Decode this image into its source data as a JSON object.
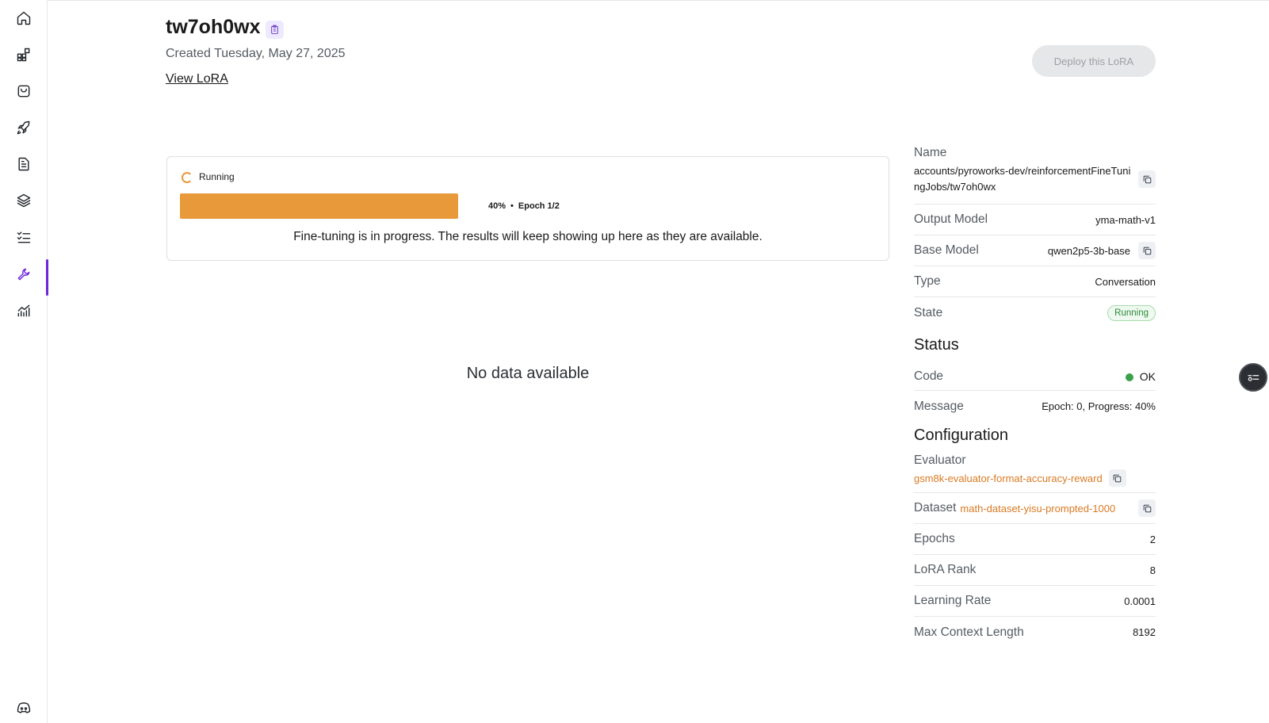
{
  "header": {
    "title": "tw7oh0wx",
    "created": "Created Tuesday, May 27, 2025",
    "view_lora": "View LoRA",
    "deploy_label": "Deploy this LoRA"
  },
  "sidebar": {
    "items": [
      {
        "name": "home",
        "icon": "home-icon"
      },
      {
        "name": "models",
        "icon": "grid-plus-icon"
      },
      {
        "name": "marketplace",
        "icon": "bag-icon"
      },
      {
        "name": "deployments",
        "icon": "rocket-icon"
      },
      {
        "name": "documents",
        "icon": "document-icon"
      },
      {
        "name": "layers",
        "icon": "layers-icon"
      },
      {
        "name": "tasks",
        "icon": "checklist-icon"
      },
      {
        "name": "fine-tuning",
        "icon": "wrench-icon",
        "active": true
      },
      {
        "name": "analytics",
        "icon": "chart-icon"
      }
    ],
    "bottom_icon": "discord-icon"
  },
  "progress": {
    "status": "Running",
    "percent": 40,
    "percent_label": "40%",
    "separator": "•",
    "epoch_label": "Epoch 1/2",
    "message": "Fine-tuning is in progress. The results will keep showing up here as they are available.",
    "bar_color": "#e8993a"
  },
  "chart_area": {
    "empty_message": "No data available"
  },
  "details": {
    "name_label": "Name",
    "name_value": "accounts/pyroworks-dev/reinforcementFineTuningJobs/tw7oh0wx",
    "output_model_label": "Output Model",
    "output_model_value": "yma-math-v1",
    "base_model_label": "Base Model",
    "base_model_value": "qwen2p5-3b-base",
    "type_label": "Type",
    "type_value": "Conversation",
    "state_label": "State",
    "state_value": "Running"
  },
  "status_section": {
    "heading": "Status",
    "code_label": "Code",
    "code_value": "OK",
    "message_label": "Message",
    "message_value": "Epoch: 0, Progress: 40%"
  },
  "config": {
    "heading": "Configuration",
    "evaluator_label": "Evaluator",
    "evaluator_value": "gsm8k-evaluator-format-accuracy-reward",
    "dataset_label": "Dataset",
    "dataset_value": "math-dataset-yisu-prompted-1000",
    "epochs_label": "Epochs",
    "epochs_value": "2",
    "lora_rank_label": "LoRA Rank",
    "lora_rank_value": "8",
    "learning_rate_label": "Learning Rate",
    "learning_rate_value": "0.0001",
    "max_context_label": "Max Context Length",
    "max_context_value": "8192"
  },
  "colors": {
    "accent": "#6d28d9",
    "progress": "#e8993a",
    "link": "#d97a23",
    "ok": "#3aa14a"
  }
}
